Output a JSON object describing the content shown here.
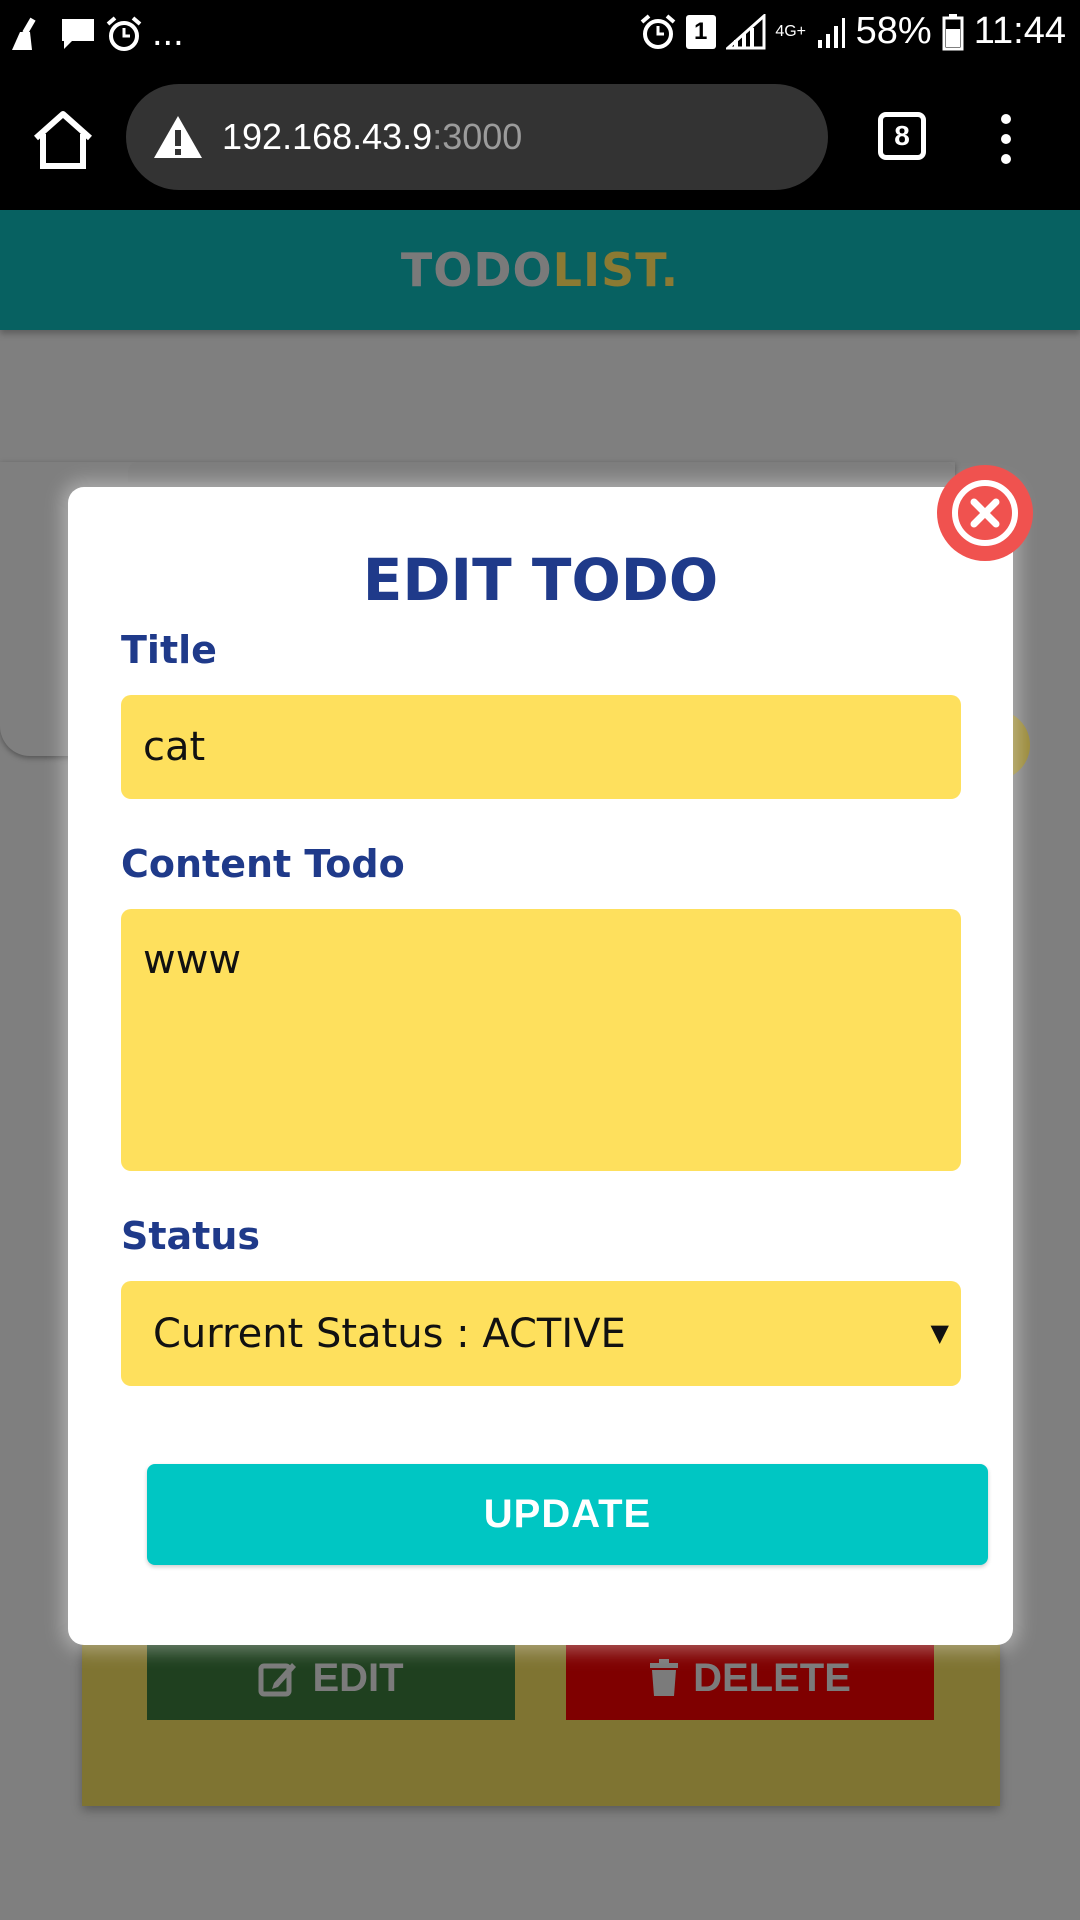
{
  "status_bar": {
    "notification_icons": [
      "broom-icon",
      "chat-icon",
      "alarm-icon"
    ],
    "overflow": "...",
    "sim_slot": "1",
    "network": "4G+",
    "battery": "58%",
    "time": "11:44"
  },
  "browser": {
    "url_host": "192.168.43.9",
    "url_port": ":3000",
    "tab_count": "8"
  },
  "app": {
    "logo_part1": "TODO",
    "logo_part2": "LIST."
  },
  "background": {
    "edit_label": "EDIT",
    "delete_label": "DELETE"
  },
  "modal": {
    "title": "EDIT TODO",
    "title_label": "Title",
    "title_value": "cat",
    "content_label": "Content Todo",
    "content_value": "www",
    "status_label": "Status",
    "status_value": "Current Status : ACTIVE",
    "update_label": "UPDATE"
  },
  "colors": {
    "modal_title": "#1f3a8a",
    "input_bg": "#fee05d",
    "update_btn": "#00c6c3",
    "close_btn": "#f0524f",
    "header_bg": "#076161"
  }
}
